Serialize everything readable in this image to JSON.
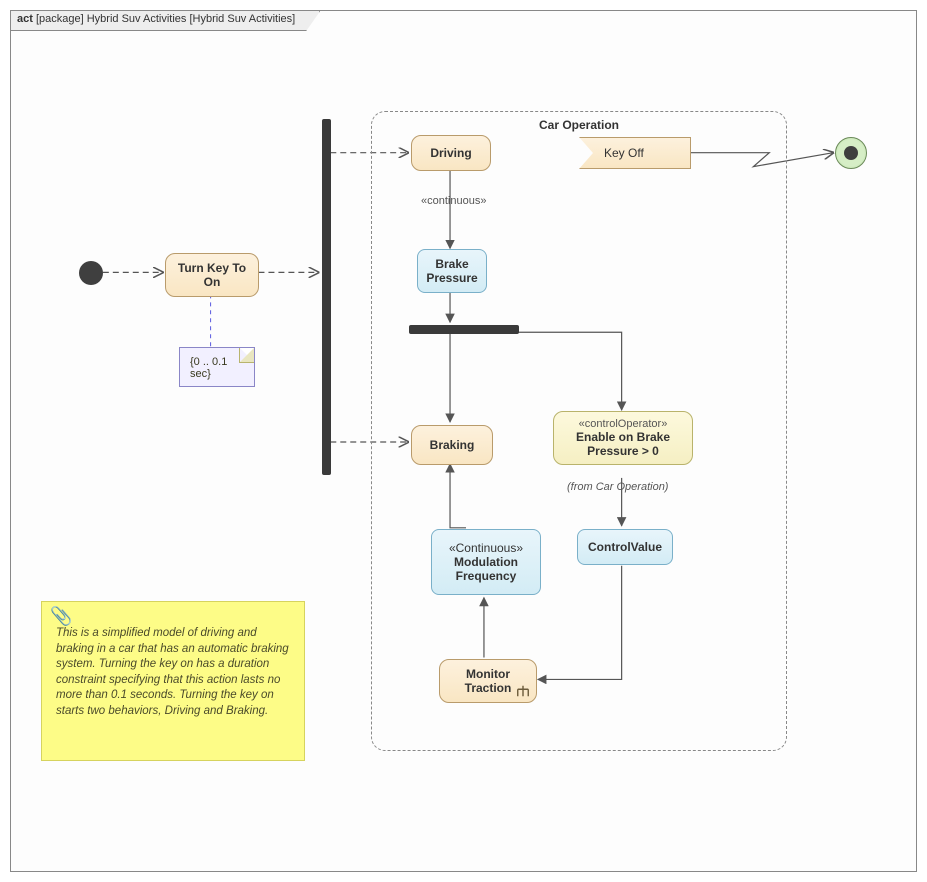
{
  "frame": {
    "kind": "act",
    "ns": "[package]",
    "title": "Hybrid Suv Activities",
    "qualifier": "[Hybrid Suv Activities]"
  },
  "nodes": {
    "turn_key": "Turn Key To\nOn",
    "driving": "Driving",
    "braking": "Braking",
    "brake_pressure": "Brake\nPressure",
    "mod_freq_stereo": "«Continuous»",
    "mod_freq": "Modulation\nFrequency",
    "monitor_traction": "Monitor\nTraction",
    "ctrl_op_stereo": "«controlOperator»",
    "ctrl_op": "Enable on Brake\nPressure > 0",
    "ctrl_op_from": "(from Car Operation)",
    "control_value": "ControlValue",
    "key_off": "Key Off"
  },
  "labels": {
    "continuous": "«continuous»"
  },
  "region": {
    "title": "Car Operation"
  },
  "constraint": {
    "text": "{0 .. 0.1 sec}"
  },
  "sticky": {
    "text": "This is a simplified model of driving and braking in a car that has an automatic braking system. Turning the key on has a duration constraint specifying that this action lasts no more than 0.1 seconds. Turning the key on starts two behaviors, Driving and Braking."
  }
}
